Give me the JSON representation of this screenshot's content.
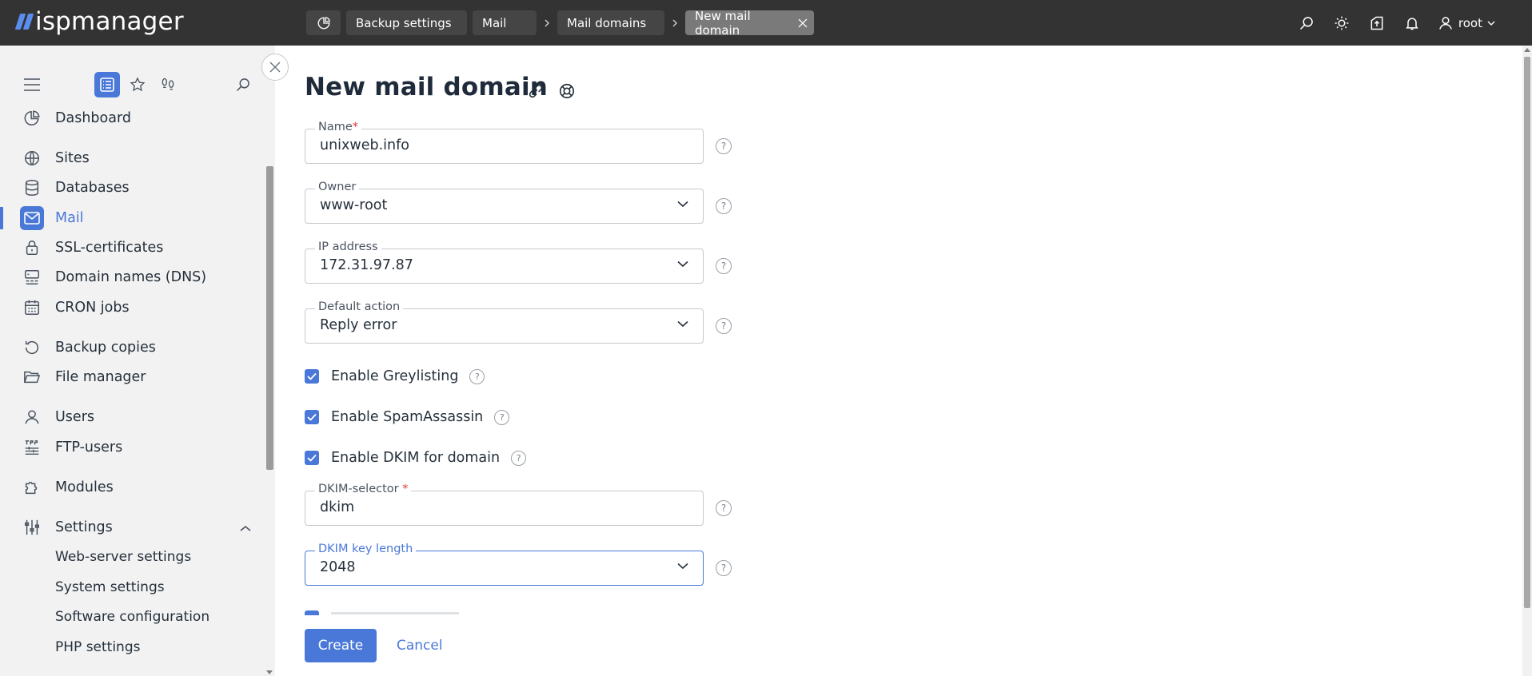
{
  "app": {
    "logo_text": "ispmanager"
  },
  "breadcrumbs": {
    "items": [
      "Backup settings",
      "Mail",
      "Mail domains"
    ],
    "active": "New mail domain"
  },
  "header": {
    "user": "root",
    "icons": [
      "search-icon",
      "sun-icon",
      "upload-icon",
      "bell-icon",
      "user-icon"
    ]
  },
  "sidebar": {
    "items": [
      {
        "label": "Dashboard",
        "icon": "dashboard-icon"
      },
      {
        "label": "Sites",
        "icon": "globe-icon"
      },
      {
        "label": "Databases",
        "icon": "database-icon"
      },
      {
        "label": "Mail",
        "icon": "mail-icon",
        "active": true
      },
      {
        "label": "SSL-certificates",
        "icon": "lock-icon"
      },
      {
        "label": "Domain names (DNS)",
        "icon": "dns-icon"
      },
      {
        "label": "CRON jobs",
        "icon": "calendar-icon"
      },
      {
        "label": "Backup copies",
        "icon": "backup-icon"
      },
      {
        "label": "File manager",
        "icon": "folder-icon"
      },
      {
        "label": "Users",
        "icon": "user-icon"
      },
      {
        "label": "FTP-users",
        "icon": "ftp-icon"
      },
      {
        "label": "Modules",
        "icon": "puzzle-icon"
      },
      {
        "label": "Settings",
        "icon": "settings-icon",
        "expanded": true
      }
    ],
    "settings_sub": [
      "Web-server settings",
      "System settings",
      "Software configuration",
      "PHP settings"
    ]
  },
  "form": {
    "title": "New mail domain",
    "name": {
      "label": "Name",
      "value": "unixweb.info"
    },
    "owner": {
      "label": "Owner",
      "value": "www-root"
    },
    "ip": {
      "label": "IP address",
      "value": "172.31.97.87"
    },
    "default_action": {
      "label": "Default action",
      "value": "Reply error"
    },
    "greylisting": {
      "label": "Enable Greylisting",
      "checked": true
    },
    "spamassassin": {
      "label": "Enable SpamAssassin",
      "checked": true
    },
    "dkim": {
      "label": "Enable DKIM for domain",
      "checked": true
    },
    "dkim_selector": {
      "label": "DKIM-selector",
      "value": "dkim"
    },
    "dkim_key_length": {
      "label": "DKIM key length",
      "value": "2048"
    },
    "help_glyph": "?",
    "required_mark": "*"
  },
  "actions": {
    "create": "Create",
    "cancel": "Cancel"
  },
  "colors": {
    "accent": "#4a78d8",
    "topbar": "#333333",
    "sidebar": "#f2f2f2",
    "required": "#e23a3a"
  }
}
